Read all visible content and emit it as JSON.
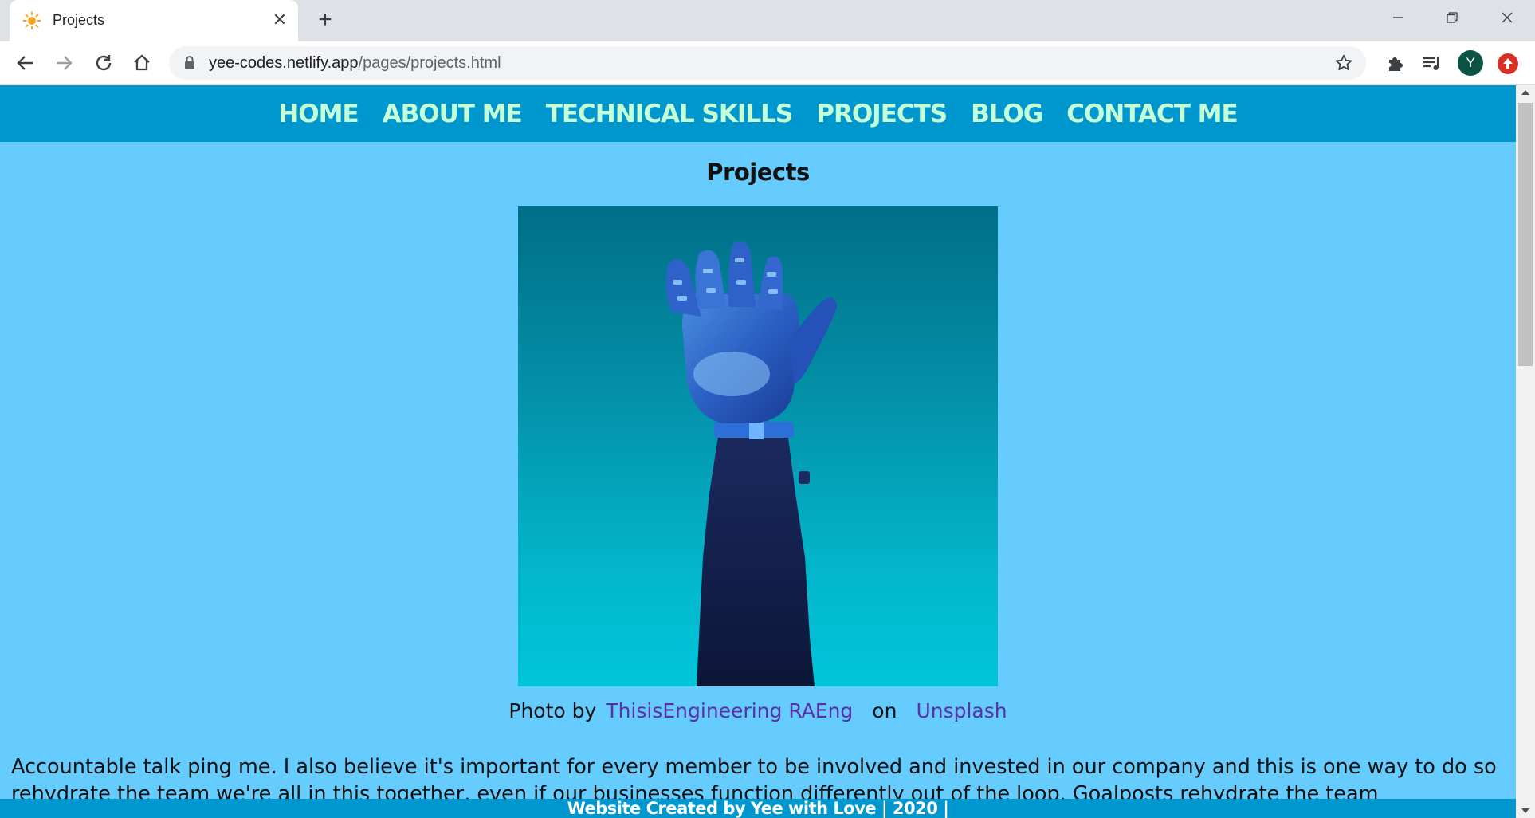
{
  "browser": {
    "tab_title": "Projects",
    "url_host": "yee-codes.netlify.app",
    "url_path": "/pages/projects.html",
    "profile_initial": "Y"
  },
  "site": {
    "nav": [
      "HOME",
      "ABOUT ME",
      "TECHNICAL SKILLS",
      "PROJECTS",
      "BLOG",
      "CONTACT ME"
    ],
    "heading": "Projects",
    "photo_alt": "robotic hand",
    "credit": {
      "prefix": "Photo by",
      "author": "ThisisEngineering RAEng",
      "on": "on",
      "source": "Unsplash"
    },
    "paragraph": "Accountable talk ping me. I also believe it's important for every member to be involved and invested in our company and this is one way to do so rehydrate the team we're all in this together, even if our businesses function differently out of the loop. Goalposts rehydrate the team",
    "footer": "Website Created by Yee with Love | 2020 |"
  },
  "colors": {
    "page_bg": "#66cbfd",
    "nav_bg": "#0097ce",
    "nav_text": "#c5ffd8",
    "link": "#5b2fa8"
  }
}
